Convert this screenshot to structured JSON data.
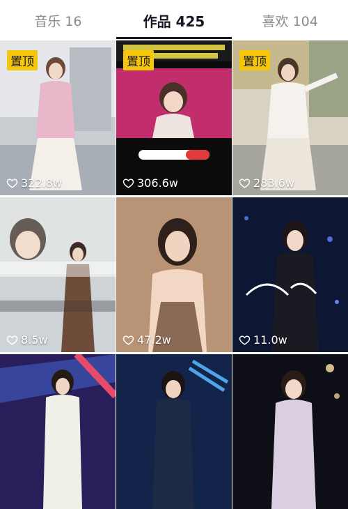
{
  "tabs": [
    {
      "label": "音乐 16",
      "active": false
    },
    {
      "label": "作品 425",
      "active": true
    },
    {
      "label": "喜欢 104",
      "active": false
    }
  ],
  "pin_label": "置顶",
  "videos": [
    {
      "likes": "322.8w",
      "pinned": true
    },
    {
      "likes": "306.6w",
      "pinned": true
    },
    {
      "likes": "283.6w",
      "pinned": true
    },
    {
      "likes": "8.5w",
      "pinned": false
    },
    {
      "likes": "47.2w",
      "pinned": false
    },
    {
      "likes": "11.0w",
      "pinned": false
    },
    {
      "likes": "",
      "pinned": false
    },
    {
      "likes": "",
      "pinned": false
    },
    {
      "likes": "",
      "pinned": false
    }
  ],
  "colors": {
    "pin_badge": "#f5c60a",
    "active_tab": "#161823",
    "inactive_tab": "#8a8a8a"
  }
}
